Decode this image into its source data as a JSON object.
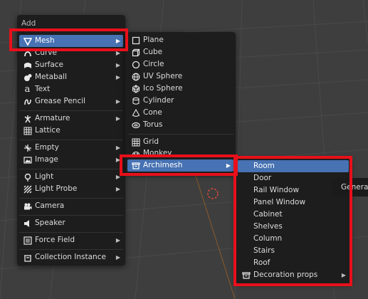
{
  "add_menu": {
    "title": "Add",
    "items": [
      {
        "label": "Mesh",
        "icon": "mesh-icon",
        "submenu": true,
        "active": true
      },
      {
        "label": "Curve",
        "icon": "curve-icon",
        "submenu": true
      },
      {
        "label": "Surface",
        "icon": "surface-icon",
        "submenu": true
      },
      {
        "label": "Metaball",
        "icon": "metaball-icon",
        "submenu": true
      },
      {
        "label": "Text",
        "icon": "text-icon"
      },
      {
        "label": "Grease Pencil",
        "icon": "grease-pencil-icon",
        "submenu": true
      },
      {
        "label": "Armature",
        "icon": "armature-icon",
        "submenu": true
      },
      {
        "label": "Lattice",
        "icon": "lattice-icon"
      },
      {
        "label": "Empty",
        "icon": "empty-icon",
        "submenu": true
      },
      {
        "label": "Image",
        "icon": "image-icon",
        "submenu": true
      },
      {
        "label": "Light",
        "icon": "light-icon",
        "submenu": true
      },
      {
        "label": "Light Probe",
        "icon": "light-probe-icon",
        "submenu": true
      },
      {
        "label": "Camera",
        "icon": "camera-icon"
      },
      {
        "label": "Speaker",
        "icon": "speaker-icon"
      },
      {
        "label": "Force Field",
        "icon": "force-field-icon",
        "submenu": true
      },
      {
        "label": "Collection Instance",
        "icon": "collection-icon",
        "submenu": true
      }
    ]
  },
  "mesh_menu": {
    "items": [
      {
        "label": "Plane",
        "icon": "plane-icon"
      },
      {
        "label": "Cube",
        "icon": "cube-icon"
      },
      {
        "label": "Circle",
        "icon": "circle-icon"
      },
      {
        "label": "UV Sphere",
        "icon": "uv-sphere-icon"
      },
      {
        "label": "Ico Sphere",
        "icon": "ico-sphere-icon"
      },
      {
        "label": "Cylinder",
        "icon": "cylinder-icon"
      },
      {
        "label": "Cone",
        "icon": "cone-icon"
      },
      {
        "label": "Torus",
        "icon": "torus-icon"
      },
      {
        "label": "Grid",
        "icon": "grid-icon"
      },
      {
        "label": "Monkey",
        "icon": "monkey-icon"
      },
      {
        "label": "Archimesh",
        "icon": "archimesh-icon",
        "submenu": true,
        "active": true
      }
    ]
  },
  "archimesh_menu": {
    "items": [
      {
        "label": "Room",
        "active": true
      },
      {
        "label": "Door"
      },
      {
        "label": "Rail Window"
      },
      {
        "label": "Panel Window"
      },
      {
        "label": "Cabinet"
      },
      {
        "label": "Shelves"
      },
      {
        "label": "Column"
      },
      {
        "label": "Stairs"
      },
      {
        "label": "Roof"
      },
      {
        "label": "Decoration props",
        "icon": "decoration-icon",
        "submenu": true
      }
    ]
  },
  "tooltip_partial": "Generate",
  "colors": {
    "menu_bg": "#1d1d1d",
    "active_bg": "#4772b3",
    "highlight_box": "#e8101a",
    "viewport_bg": "#3e3e3e"
  }
}
